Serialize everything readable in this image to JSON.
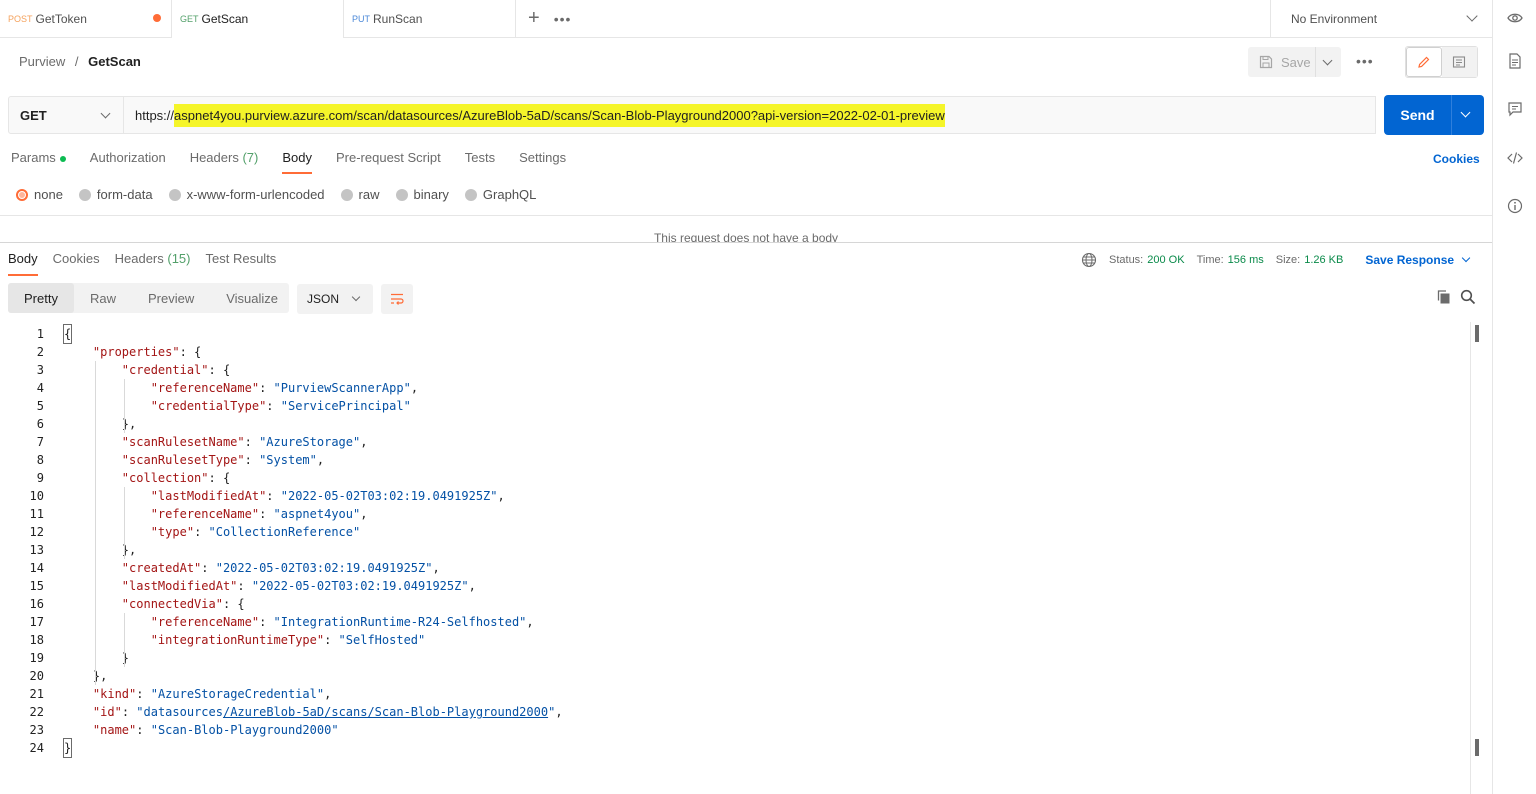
{
  "tabs": [
    {
      "method": "POST",
      "name": "GetToken",
      "unsaved": true
    },
    {
      "method": "GET",
      "name": "GetScan",
      "unsaved": false
    },
    {
      "method": "PUT",
      "name": "RunScan",
      "unsaved": false
    }
  ],
  "environment": "No Environment",
  "breadcrumb": {
    "collection": "Purview",
    "separator": "/",
    "request": "GetScan"
  },
  "toolbar": {
    "save_label": "Save"
  },
  "request": {
    "method": "GET",
    "url_prefix": "https://",
    "url_highlighted": "aspnet4you.purview.azure.com/scan/datasources/AzureBlob-5aD/scans/Scan-Blob-Playground2000?api-version=2022-02-01-preview",
    "send_label": "Send"
  },
  "request_tabs": {
    "params": "Params",
    "authorization": "Authorization",
    "headers": "Headers",
    "headers_count": "(7)",
    "body": "Body",
    "prerequest": "Pre-request Script",
    "tests": "Tests",
    "settings": "Settings",
    "cookies": "Cookies"
  },
  "body_types": [
    "none",
    "form-data",
    "x-www-form-urlencoded",
    "raw",
    "binary",
    "GraphQL"
  ],
  "no_body_message": "This request does not have a body",
  "response_tabs": {
    "body": "Body",
    "cookies": "Cookies",
    "headers": "Headers",
    "headers_count": "(15)",
    "test_results": "Test Results"
  },
  "response_status": {
    "status_label": "Status:",
    "status_value": "200 OK",
    "time_label": "Time:",
    "time_value": "156 ms",
    "size_label": "Size:",
    "size_value": "1.26 KB",
    "save_response": "Save Response"
  },
  "view_modes": [
    "Pretty",
    "Raw",
    "Preview",
    "Visualize"
  ],
  "format": "JSON",
  "code_lines": [
    "{",
    "    \"properties\": {",
    "        \"credential\": {",
    "            \"referenceName\": \"PurviewScannerApp\",",
    "            \"credentialType\": \"ServicePrincipal\"",
    "        },",
    "        \"scanRulesetName\": \"AzureStorage\",",
    "        \"scanRulesetType\": \"System\",",
    "        \"collection\": {",
    "            \"lastModifiedAt\": \"2022-05-02T03:02:19.0491925Z\",",
    "            \"referenceName\": \"aspnet4you\",",
    "            \"type\": \"CollectionReference\"",
    "        },",
    "        \"createdAt\": \"2022-05-02T03:02:19.0491925Z\",",
    "        \"lastModifiedAt\": \"2022-05-02T03:02:19.0491925Z\",",
    "        \"connectedVia\": {",
    "            \"referenceName\": \"IntegrationRuntime-R24-Selfhosted\",",
    "            \"integrationRuntimeType\": \"SelfHosted\"",
    "        }",
    "    },",
    "    \"kind\": \"AzureStorageCredential\",",
    "    \"id\": \"datasources/AzureBlob-5aD/scans/Scan-Blob-Playground2000\",",
    "    \"name\": \"Scan-Blob-Playground2000\"",
    "}"
  ],
  "colors": {
    "accent": "#ff6c37",
    "send_blue": "#0265d2",
    "url_highlight": "#f5f52a",
    "json_key": "#a31515",
    "json_string": "#0451a5",
    "status_green": "#0a8a4a"
  }
}
